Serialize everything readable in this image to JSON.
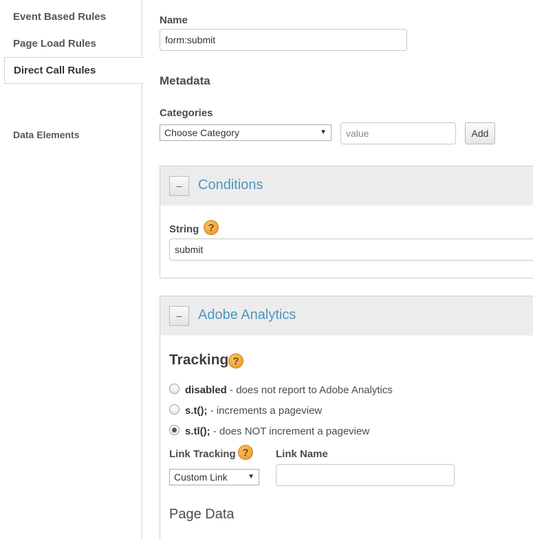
{
  "sidebar": {
    "items": [
      {
        "label": "Event Based Rules"
      },
      {
        "label": "Page Load Rules"
      },
      {
        "label": "Direct Call Rules"
      },
      {
        "label": "Data Elements"
      }
    ]
  },
  "name": {
    "label": "Name",
    "value": "form:submit"
  },
  "metadata": {
    "heading": "Metadata",
    "categories_label": "Categories",
    "category_selected": "Choose Category",
    "value_placeholder": "value",
    "add_label": "Add"
  },
  "conditions": {
    "collapse_label": "–",
    "title": "Conditions",
    "string_label": "String",
    "help_glyph": "?",
    "string_value": "submit"
  },
  "analytics": {
    "collapse_label": "–",
    "title": "Adobe Analytics",
    "tracking_heading": "Tracking",
    "help_glyph": "?",
    "options": [
      {
        "code": "disabled",
        "desc": " - does not report to Adobe Analytics",
        "checked": false
      },
      {
        "code": "s.t();",
        "desc": " - increments a pageview",
        "checked": false
      },
      {
        "code": "s.tl();",
        "desc": " - does NOT increment a pageview",
        "checked": true
      }
    ],
    "link_tracking_label": "Link Tracking",
    "link_tracking_selected": "Custom Link",
    "link_name_label": "Link Name",
    "link_name_value": "",
    "page_data_heading": "Page Data"
  },
  "icons": {
    "help": "help-icon",
    "dropdown": "chevron-down-icon"
  },
  "colors": {
    "panel_title": "#4a96c5",
    "help_icon": "#e8901c"
  }
}
